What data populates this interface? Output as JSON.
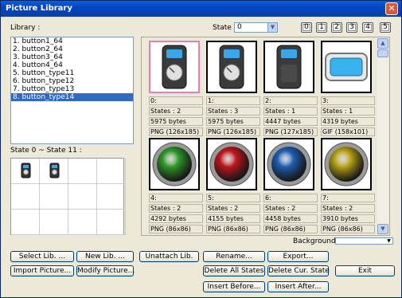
{
  "window": {
    "title": "Picture Library",
    "close_glyph": "✕"
  },
  "library": {
    "label": "Library :",
    "items": [
      "1. button1_64",
      "2. button2_64",
      "3. button3_64",
      "4. button4_64",
      "5. button_type11",
      "6. button_type12",
      "7. button_type13",
      "8. button_type14"
    ],
    "selected_index": 7
  },
  "state": {
    "label": "State :",
    "value": "0",
    "arrow_glyph": "▼"
  },
  "pages": [
    "0",
    "1",
    "2",
    "3",
    "4",
    "5"
  ],
  "state_range_label": "State 0 ~ State 11 :",
  "state_thumbs": [
    {
      "name": "state-0-thumb",
      "icon": "device-icon"
    },
    {
      "name": "state-1-thumb",
      "icon": "device-icon"
    }
  ],
  "pictures": [
    {
      "index": "0:",
      "states": "States : 2",
      "size": "5975 bytes",
      "format": "PNG (126x185)",
      "kind": "remote-dial",
      "selected": true
    },
    {
      "index": "1:",
      "states": "States : 3",
      "size": "5975 bytes",
      "format": "PNG (126x185)",
      "kind": "remote-dial",
      "selected": false
    },
    {
      "index": "2:",
      "states": "States : 1",
      "size": "4447 bytes",
      "format": "PNG (127x185)",
      "kind": "remote-plain",
      "selected": false
    },
    {
      "index": "3:",
      "states": "States : 1",
      "size": "4319 bytes",
      "format": "GIF (158x101)",
      "kind": "display",
      "selected": false
    },
    {
      "index": "4:",
      "states": "States : 2",
      "size": "4292 bytes",
      "format": "PNG (86x86)",
      "kind": "round",
      "color": "#2f9a2a",
      "selected": false
    },
    {
      "index": "5:",
      "states": "States : 2",
      "size": "4155 bytes",
      "format": "PNG (86x86)",
      "kind": "round",
      "color": "#c0171d",
      "selected": false
    },
    {
      "index": "6:",
      "states": "States : 2",
      "size": "4458 bytes",
      "format": "PNG (86x86)",
      "kind": "round",
      "color": "#1f5fb4",
      "selected": false
    },
    {
      "index": "7:",
      "states": "States : 2",
      "size": "3910 bytes",
      "format": "PNG (86x86)",
      "kind": "round",
      "color": "#b9a418",
      "selected": false
    }
  ],
  "background": {
    "label": "Background :"
  },
  "buttons": {
    "select_lib": "Select Lib. ...",
    "new_lib": "New Lib. ...",
    "unattach_lib": "Unattach Lib.",
    "rename": "Rename...",
    "export": "Export...",
    "import_picture": "Import Picture...",
    "modify_picture": "Modify Picture...",
    "delete_all_states": "Delete All States",
    "delete_cur_state": "Delete Cur. State",
    "exit": "Exit",
    "insert_before": "Insert Before...",
    "insert_after": "Insert After..."
  }
}
